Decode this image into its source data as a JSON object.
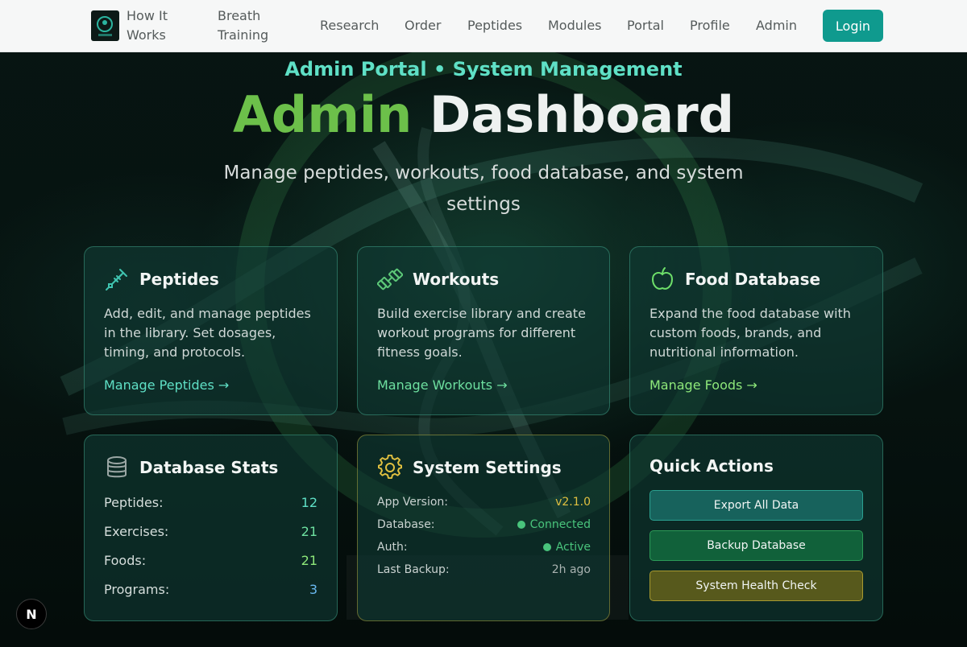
{
  "nav": {
    "links": [
      "How It Works",
      "Breath Training",
      "Research",
      "Order",
      "Peptides",
      "Modules",
      "Portal",
      "Profile",
      "Admin"
    ],
    "login_label": "Login"
  },
  "hero": {
    "eyebrow": "Admin Portal • System Management",
    "title_part1": "Admin",
    "title_part2": "Dashboard",
    "subtitle": "Manage peptides, workouts, food database, and system settings"
  },
  "cards": {
    "peptides": {
      "title": "Peptides",
      "description": "Add, edit, and manage peptides in the library. Set dosages, timing, and protocols.",
      "link": "Manage Peptides →"
    },
    "workouts": {
      "title": "Workouts",
      "description": "Build exercise library and create workout programs for different fitness goals.",
      "link": "Manage Workouts →"
    },
    "foods": {
      "title": "Food Database",
      "description": "Expand the food database with custom foods, brands, and nutritional information.",
      "link": "Manage Foods →"
    }
  },
  "stats": {
    "title": "Database Stats",
    "rows": [
      {
        "label": "Peptides:",
        "value": "12"
      },
      {
        "label": "Exercises:",
        "value": "21"
      },
      {
        "label": "Foods:",
        "value": "21"
      },
      {
        "label": "Programs:",
        "value": "3"
      }
    ]
  },
  "system": {
    "title": "System Settings",
    "rows": [
      {
        "label": "App Version:",
        "value": "v2.1.0"
      },
      {
        "label": "Database:",
        "value": "Connected"
      },
      {
        "label": "Auth:",
        "value": "Active"
      },
      {
        "label": "Last Backup:",
        "value": "2h ago"
      }
    ]
  },
  "quick_actions": {
    "title": "Quick Actions",
    "buttons": [
      "Export All Data",
      "Backup Database",
      "System Health Check"
    ]
  },
  "corner_badge": "N",
  "colors": {
    "accent_teal": "#0f9a8e",
    "accent_cyan": "#5fe0c6",
    "accent_green": "#6cc04a",
    "gold": "#e0c040",
    "status_green": "#49c47c"
  }
}
